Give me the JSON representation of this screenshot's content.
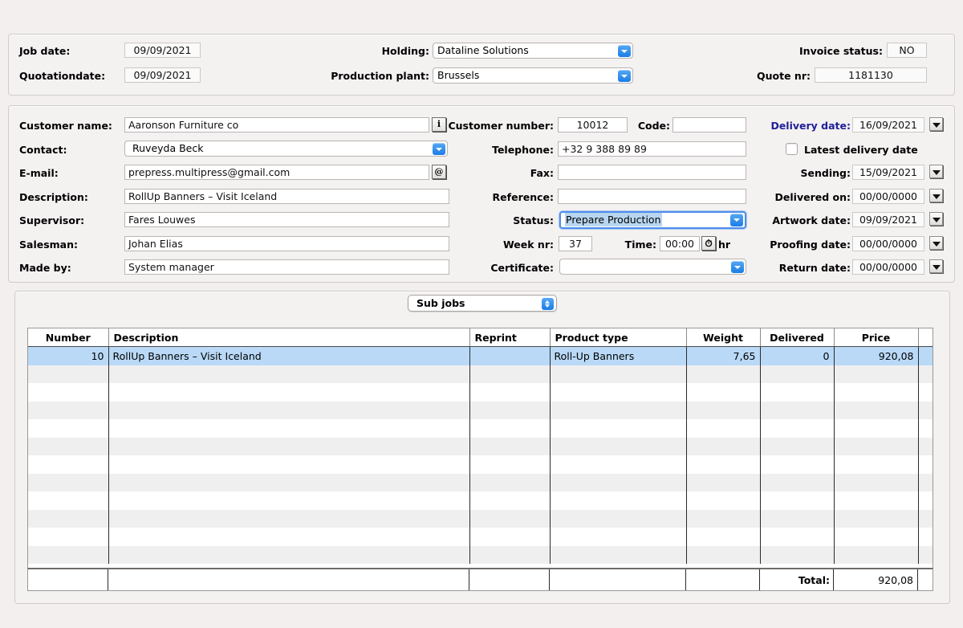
{
  "header": {
    "job_date_label": "Job date:",
    "job_date_value": "09/09/2021",
    "quotation_date_label": "Quotationdate:",
    "quotation_date_value": "09/09/2021",
    "holding_label": "Holding:",
    "holding_value": "Dataline Solutions",
    "production_plant_label": "Production plant:",
    "production_plant_value": "Brussels",
    "invoice_status_label": "Invoice status:",
    "invoice_status_value": "NO",
    "quote_nr_label": "Quote nr:",
    "quote_nr_value": "1181130"
  },
  "customer": {
    "customer_name_label": "Customer name:",
    "customer_name_value": "Aaronson Furniture co",
    "info_button_glyph": "i",
    "contact_label": "Contact:",
    "contact_value": "Ruveyda Beck",
    "email_label": "E-mail:",
    "email_value": "prepress.multipress@gmail.com",
    "email_button_glyph": "@",
    "description_label": "Description:",
    "description_value": "RollUp Banners – Visit Iceland",
    "supervisor_label": "Supervisor:",
    "supervisor_value": "Fares Louwes",
    "salesman_label": "Salesman:",
    "salesman_value": "Johan Elias",
    "made_by_label": "Made by:",
    "made_by_value": "System manager",
    "customer_number_label": "Customer number:",
    "customer_number_value": "10012",
    "code_label": "Code:",
    "code_value": "",
    "telephone_label": "Telephone:",
    "telephone_value": "+32 9 388 89 89",
    "fax_label": "Fax:",
    "fax_value": "",
    "reference_label": "Reference:",
    "reference_value": "",
    "status_label": "Status:",
    "status_value": "Prepare Production",
    "week_nr_label": "Week nr:",
    "week_nr_value": "37",
    "time_label": "Time:",
    "time_value": "00:00",
    "time_unit": "hr",
    "certificate_label": "Certificate:",
    "certificate_value": ""
  },
  "dates": {
    "delivery_date_label": "Delivery date:",
    "delivery_date_value": "16/09/2021",
    "latest_delivery_date_label": "Latest delivery date",
    "latest_delivery_date_checked": false,
    "sending_label": "Sending:",
    "sending_value": "15/09/2021",
    "delivered_on_label": "Delivered on:",
    "delivered_on_value": "00/00/0000",
    "artwork_date_label": "Artwork date:",
    "artwork_date_value": "09/09/2021",
    "proofing_date_label": "Proofing date:",
    "proofing_date_value": "00/00/0000",
    "return_date_label": "Return date:",
    "return_date_value": "00/00/0000"
  },
  "subjobs": {
    "selector_label": "Sub jobs",
    "columns": [
      "Number",
      "Description",
      "Reprint",
      "Product type",
      "Weight",
      "Delivered",
      "Price"
    ],
    "rows": [
      {
        "number": "10",
        "description": "RollUp Banners – Visit Iceland",
        "reprint": "",
        "product_type": "Roll-Up Banners",
        "weight": "7,65",
        "delivered": "0",
        "price": "920,08",
        "selected": true
      }
    ],
    "empty_row_count": 11,
    "total_label": "Total:",
    "total_value": "920,08"
  },
  "colors": {
    "accent_blue": "#1a7de6",
    "selection_blue": "#b9d9f7",
    "delivery_label_blue": "#20209a",
    "page_background": "#f2efee"
  }
}
